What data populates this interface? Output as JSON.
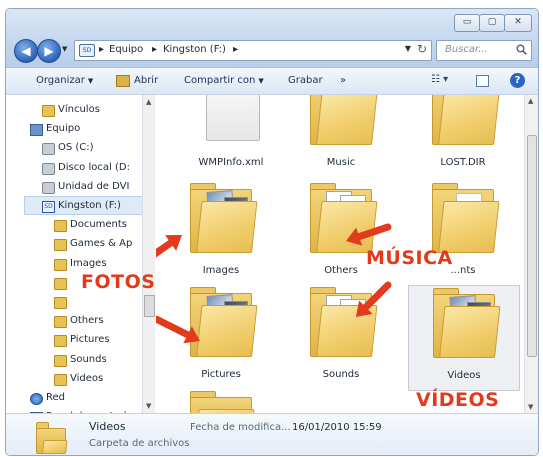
{
  "window": {
    "buttons": {
      "minimize": "▭",
      "maximize": "▢",
      "close": "✕"
    }
  },
  "address": {
    "drive_icon_text": "SD",
    "crumbs": [
      "Equipo",
      "Kingston (F:)"
    ],
    "search_placeholder": "Buscar..."
  },
  "toolbar": {
    "organize": "Organizar",
    "open": "Abrir",
    "share": "Compartir con",
    "burn": "Grabar",
    "more": "»"
  },
  "navpane": {
    "items": [
      {
        "label": "Vínculos",
        "icon": "folder"
      },
      {
        "label": "Equipo",
        "icon": "computer"
      },
      {
        "label": "OS (C:)",
        "icon": "drive"
      },
      {
        "label": "Disco local (D:",
        "icon": "drive"
      },
      {
        "label": "Unidad de DVI",
        "icon": "drive"
      },
      {
        "label": "Kingston (F:)",
        "icon": "sd"
      },
      {
        "label": "Documents",
        "icon": "folder"
      },
      {
        "label": "Games & Ap",
        "icon": "folder"
      },
      {
        "label": "Images",
        "icon": "folder"
      },
      {
        "label": "",
        "icon": "folder"
      },
      {
        "label": "",
        "icon": "folder"
      },
      {
        "label": "Others",
        "icon": "folder"
      },
      {
        "label": "Pictures",
        "icon": "folder"
      },
      {
        "label": "Sounds",
        "icon": "folder"
      },
      {
        "label": "Videos",
        "icon": "folder"
      },
      {
        "label": "Red",
        "icon": "net"
      },
      {
        "label": "Panel de control",
        "icon": "panel"
      }
    ]
  },
  "files": [
    {
      "name": "WMPInfo.xml",
      "kind": "xml"
    },
    {
      "name": "Music",
      "kind": "folder"
    },
    {
      "name": "LOST.DIR",
      "kind": "folder"
    },
    {
      "name": "Images",
      "kind": "photos"
    },
    {
      "name": "Others",
      "kind": "music"
    },
    {
      "name": "...nts",
      "kind": "folder"
    },
    {
      "name": "Pictures",
      "kind": "photos"
    },
    {
      "name": "Sounds",
      "kind": "music"
    },
    {
      "name": "Videos",
      "kind": "photos",
      "selected": true
    }
  ],
  "callouts": {
    "fotos": "FOTOS",
    "musica": "MÚSICA",
    "videos": "VÍDEOS"
  },
  "details": {
    "name": "Videos",
    "type": "Carpeta de archivos",
    "modified_label": "Fecha de modifica...",
    "modified_value": "16/01/2010 15:59"
  },
  "colors": {
    "accent": "#e23a1c",
    "folder": "#e7c254",
    "titlebar": "#c2d6ee"
  }
}
